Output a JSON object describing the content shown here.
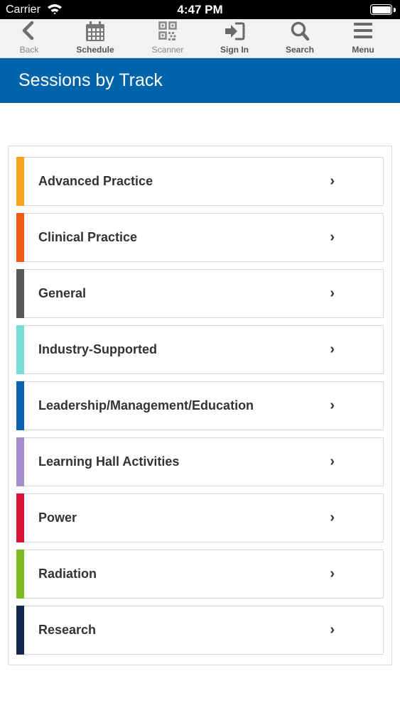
{
  "status_bar": {
    "carrier": "Carrier",
    "time": "4:47 PM"
  },
  "toolbar": {
    "items": [
      {
        "label": "Back",
        "icon": "chevron-left-icon"
      },
      {
        "label": "Schedule",
        "icon": "calendar-icon"
      },
      {
        "label": "Scanner",
        "icon": "qr-code-icon"
      },
      {
        "label": "Sign In",
        "icon": "sign-in-icon"
      },
      {
        "label": "Search",
        "icon": "search-icon"
      },
      {
        "label": "Menu",
        "icon": "hamburger-menu-icon"
      }
    ]
  },
  "header": {
    "title": "Sessions by Track",
    "background": "#0064ab"
  },
  "tracks": [
    {
      "label": "Advanced Practice",
      "color": "#f7a21b"
    },
    {
      "label": "Clinical Practice",
      "color": "#f25a14"
    },
    {
      "label": "General",
      "color": "#58595b"
    },
    {
      "label": "Industry-Supported",
      "color": "#7adcd6"
    },
    {
      "label": "Leadership/Management/Education",
      "color": "#0b62b0"
    },
    {
      "label": "Learning Hall Activities",
      "color": "#a78bd1"
    },
    {
      "label": "Power",
      "color": "#da1439"
    },
    {
      "label": "Radiation",
      "color": "#7dbb22"
    },
    {
      "label": "Research",
      "color": "#14294f"
    }
  ],
  "chevron": "›"
}
